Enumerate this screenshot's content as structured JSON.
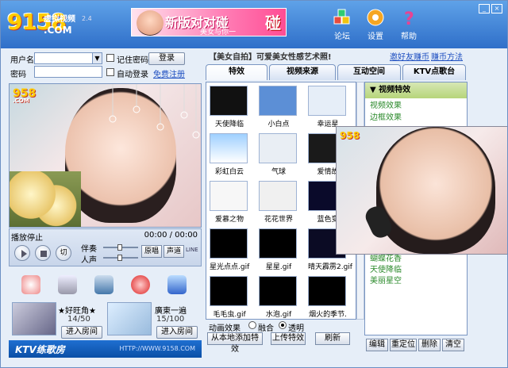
{
  "header": {
    "logo_digits": "9158",
    "logo_com": ".COM",
    "logo_sub": "虚拟视频",
    "logo_ver": "2.4",
    "banner_big": "新版对对碰",
    "banner_small": "美女与你一",
    "banner_peng": "碰",
    "buttons": [
      {
        "label": "论坛",
        "icon": "cubes-icon"
      },
      {
        "label": "设置",
        "icon": "gear-icon"
      },
      {
        "label": "帮助",
        "icon": "help-icon"
      }
    ]
  },
  "login": {
    "username_label": "用户名",
    "password_label": "密码",
    "remember_label": "记住密码",
    "autologin_label": "自动登录",
    "login_button": "登录",
    "register_link": "免费注册"
  },
  "player": {
    "status": "播放停止",
    "time": "00:00 / 00:00",
    "accompany_label": "伴奏",
    "vocal_label": "人声",
    "original_btn": "原唱",
    "channel_btn": "声道",
    "line_label": "LINE",
    "cut_btn": "切"
  },
  "watermark": {
    "digits": "958",
    "com": ".COM"
  },
  "rooms": [
    {
      "name": "★好旺角★",
      "count": "14/50",
      "enter": "进入房间"
    },
    {
      "name": "廣東一遍",
      "count": "15/100",
      "enter": "进入房间"
    }
  ],
  "ktv": {
    "title": "KTV练歌房",
    "url": "HTTP://WWW.9158.COM"
  },
  "notice": {
    "text": "【美女自拍】可爱美女性感艺术照!",
    "link1": "邀好友赚币",
    "link2": "赚币方法"
  },
  "tabs": [
    "特效",
    "视频来源",
    "互动空间",
    "KTV点歌台"
  ],
  "effects_grid": [
    "天使降临",
    "小白点",
    "幸运星",
    "彩虹白云",
    "气球",
    "爱情故",
    "爱慕之物",
    "花花世界",
    "蓝色变",
    "星光点点.gif",
    "星星.gif",
    "晴天霹雳2.gif",
    "毛毛虫.gif",
    "水泡.gif",
    "烟火的季节."
  ],
  "bottom": {
    "anim_label": "动画效果",
    "blend_label": "融合",
    "transparent_label": "透明",
    "add_local": "从本地添加特效",
    "upload": "上传特效",
    "refresh": "刷新"
  },
  "effects_list": {
    "header": "视频特效",
    "selected": "视频效果",
    "sub": "边框效果",
    "items": [
      "蝴蝶花香",
      "天使降临",
      "美丽星空"
    ]
  },
  "action_buttons": [
    "编辑",
    "重定位",
    "删除",
    "清空"
  ],
  "preview_watermark": "958"
}
